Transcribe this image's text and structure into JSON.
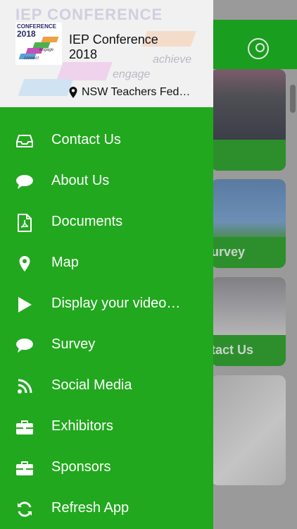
{
  "header": {
    "app_title": "IEP Conference 2018",
    "location": "NSW Teachers Fed…",
    "watermark": {
      "heading": "IEP CONFERENCE",
      "words": [
        "achieve",
        "engage"
      ]
    },
    "logo": {
      "heading": "CONFERENCE",
      "year": "2018",
      "words": [
        "engage",
        "connect"
      ]
    }
  },
  "menu": {
    "items": [
      {
        "label": "Contact Us",
        "icon": "inbox-icon"
      },
      {
        "label": "About Us",
        "icon": "speech-bubble-icon"
      },
      {
        "label": "Documents",
        "icon": "pdf-document-icon"
      },
      {
        "label": "Map",
        "icon": "map-pin-icon"
      },
      {
        "label": "Display your video…",
        "icon": "play-icon"
      },
      {
        "label": "Survey",
        "icon": "speech-bubble-icon"
      },
      {
        "label": "Social Media",
        "icon": "rss-feed-icon"
      },
      {
        "label": "Exhibitors",
        "icon": "briefcase-icon"
      },
      {
        "label": "Sponsors",
        "icon": "briefcase-icon"
      },
      {
        "label": "Refresh App",
        "icon": "refresh-icon"
      }
    ]
  },
  "background_cards": [
    {
      "caption": ""
    },
    {
      "caption": "urvey"
    },
    {
      "caption": "tact Us"
    },
    {
      "caption": ""
    }
  ],
  "colors": {
    "drawer_green": "#21a81e",
    "header_bg": "#f1f1f1",
    "text_white": "#ffffff"
  }
}
